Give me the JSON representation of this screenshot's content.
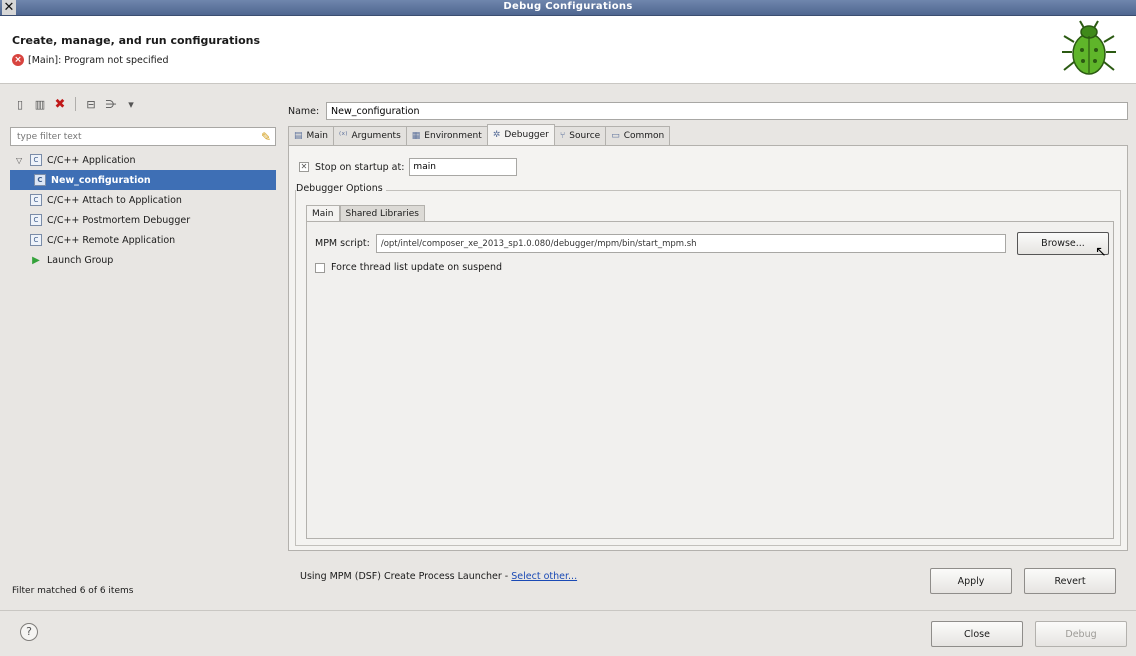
{
  "window": {
    "title": "Debug Configurations"
  },
  "header": {
    "title": "Create, manage, and run configurations",
    "message": "[Main]: Program not specified"
  },
  "left": {
    "filter_placeholder": "type filter text",
    "tree": [
      {
        "label": "C/C++ Application"
      },
      {
        "label": "New_configuration"
      },
      {
        "label": "C/C++ Attach to Application"
      },
      {
        "label": "C/C++ Postmortem Debugger"
      },
      {
        "label": "C/C++ Remote Application"
      },
      {
        "label": "Launch Group"
      }
    ],
    "status": "Filter matched 6 of 6 items"
  },
  "right": {
    "name_label": "Name:",
    "name_value": "New_configuration",
    "tabs": [
      "Main",
      "Arguments",
      "Environment",
      "Debugger",
      "Source",
      "Common"
    ],
    "stop_label": "Stop on startup at:",
    "stop_value": "main",
    "group_label": "Debugger Options",
    "subtabs": [
      "Main",
      "Shared Libraries"
    ],
    "mpm_label": "MPM script:",
    "mpm_value": "/opt/intel/composer_xe_2013_sp1.0.080/debugger/mpm/bin/start_mpm.sh",
    "browse_label": "Browse...",
    "force_label": "Force thread list update on suspend",
    "launcher_text": "Using MPM (DSF) Create Process Launcher - ",
    "launcher_link": "Select other...",
    "apply_label": "Apply",
    "revert_label": "Revert"
  },
  "footer": {
    "close_label": "Close",
    "debug_label": "Debug"
  }
}
